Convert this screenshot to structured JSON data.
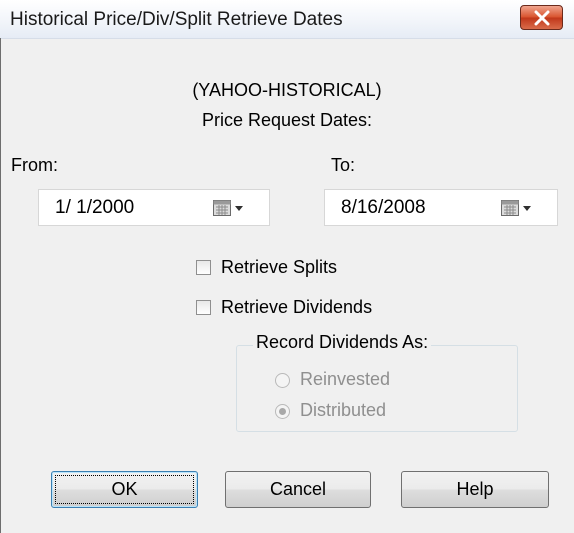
{
  "window": {
    "title": "Historical Price/Div/Split Retrieve Dates",
    "close_icon": "close-icon"
  },
  "header": {
    "source": "(YAHOO-HISTORICAL)",
    "subtitle": "Price Request Dates:"
  },
  "from": {
    "label": "From:",
    "value": "1/ 1/2000",
    "icon": "calendar-dropdown-icon"
  },
  "to": {
    "label": "To:",
    "value": "8/16/2008",
    "icon": "calendar-dropdown-icon"
  },
  "options": {
    "retrieve_splits": {
      "label": "Retrieve Splits",
      "checked": false
    },
    "retrieve_dividends": {
      "label": "Retrieve Dividends",
      "checked": false
    }
  },
  "record_dividends": {
    "title": "Record Dividends As:",
    "reinvested_label": "Reinvested",
    "distributed_label": "Distributed",
    "selected": "Distributed",
    "enabled": false
  },
  "buttons": {
    "ok_label": "OK",
    "cancel_label": "Cancel",
    "help_label": "Help"
  },
  "colors": {
    "dialog_background": "#f0f0f0",
    "close_button": "#c1371a",
    "disabled_text": "#8f8f8f"
  }
}
